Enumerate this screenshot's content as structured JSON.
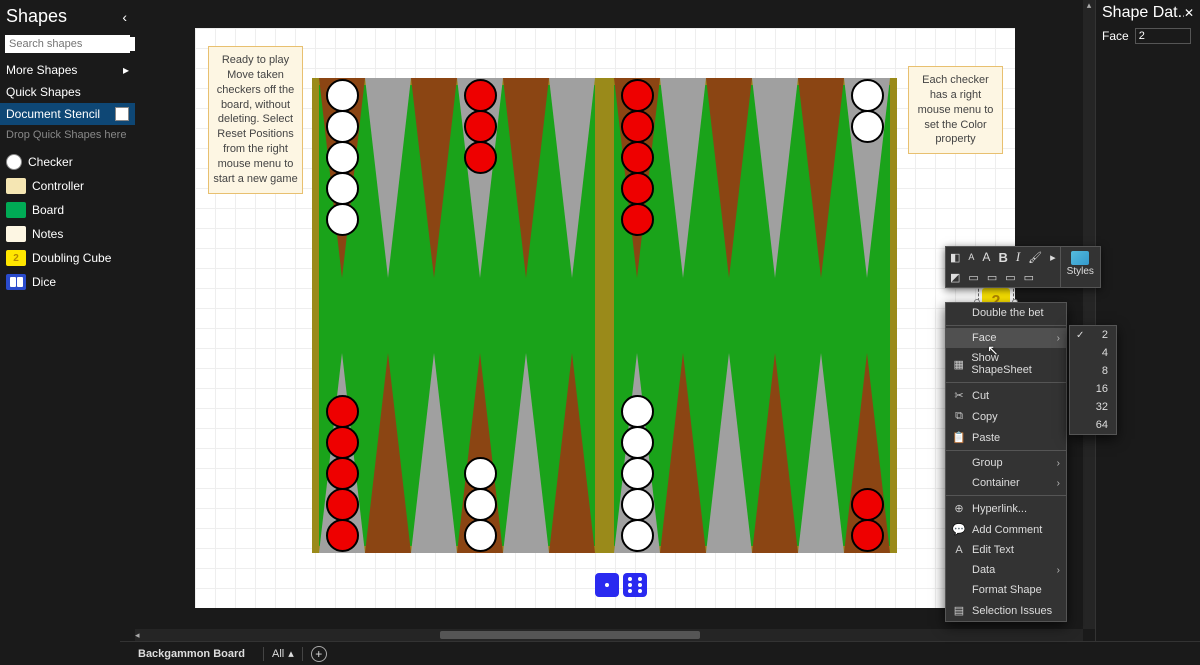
{
  "left": {
    "title": "Shapes",
    "search_placeholder": "Search shapes",
    "more_shapes": "More Shapes",
    "quick_shapes": "Quick Shapes",
    "document_stencil": "Document Stencil",
    "drop_quick": "Drop Quick Shapes here",
    "items": [
      {
        "label": "Checker",
        "cls": "checker"
      },
      {
        "label": "Controller",
        "cls": "ctrl"
      },
      {
        "label": "Board",
        "cls": "brd"
      },
      {
        "label": "Notes",
        "cls": "notes"
      },
      {
        "label": "Doubling Cube",
        "cls": "cube",
        "glyph": "2"
      },
      {
        "label": "Dice",
        "cls": "dice"
      }
    ]
  },
  "notes": {
    "n1": "Ready to play\nMove taken checkers off the board, without deleting. Select Reset Positions from the right mouse menu to start a new game",
    "n2": "Each checker has a right mouse menu to set the Color property"
  },
  "cube": {
    "value": "2"
  },
  "dice": {
    "d1": 1,
    "d2": 6
  },
  "mini_toolbar": {
    "font_large": "A",
    "font_small": "A",
    "bold": "B",
    "italic": "I",
    "styles": "Styles"
  },
  "context_menu": {
    "items": [
      {
        "label": "Double the bet",
        "type": "action"
      },
      {
        "label": "Face",
        "type": "sub",
        "hover": true
      },
      {
        "label": "Show ShapeSheet",
        "type": "action",
        "icon": "▦"
      },
      {
        "label": "Cut",
        "type": "action",
        "icon": "✂"
      },
      {
        "label": "Copy",
        "type": "action",
        "icon": "⧉"
      },
      {
        "label": "Paste",
        "type": "action",
        "icon": "📋"
      },
      {
        "label": "Group",
        "type": "sub"
      },
      {
        "label": "Container",
        "type": "sub"
      },
      {
        "label": "Hyperlink...",
        "type": "action",
        "icon": "⊕"
      },
      {
        "label": "Add Comment",
        "type": "action",
        "icon": "💬"
      },
      {
        "label": "Edit Text",
        "type": "action",
        "icon": "A"
      },
      {
        "label": "Data",
        "type": "sub"
      },
      {
        "label": "Format Shape",
        "type": "action"
      },
      {
        "label": "Selection Issues",
        "type": "action",
        "icon": "▤"
      }
    ],
    "face_submenu": {
      "options": [
        "2",
        "4",
        "8",
        "16",
        "32",
        "64"
      ],
      "selected": "2"
    }
  },
  "right": {
    "title": "Shape Dat...",
    "prop_label": "Face",
    "prop_value": "2"
  },
  "bottom": {
    "tab": "Backgammon Board",
    "all": "All"
  },
  "board": {
    "points_top": [
      {
        "col": 0,
        "half": "lh",
        "color": "w",
        "n": 5
      },
      {
        "col": 3,
        "half": "lh",
        "color": "r",
        "n": 3
      },
      {
        "col": 0,
        "half": "rh",
        "color": "r",
        "n": 5
      },
      {
        "col": 5,
        "half": "rh",
        "color": "w",
        "n": 2
      }
    ],
    "points_bot": [
      {
        "col": 0,
        "half": "lh",
        "color": "r",
        "n": 5
      },
      {
        "col": 3,
        "half": "lh",
        "color": "w",
        "n": 3
      },
      {
        "col": 0,
        "half": "rh",
        "color": "w",
        "n": 5
      },
      {
        "col": 5,
        "half": "rh",
        "color": "r",
        "n": 2
      }
    ]
  }
}
